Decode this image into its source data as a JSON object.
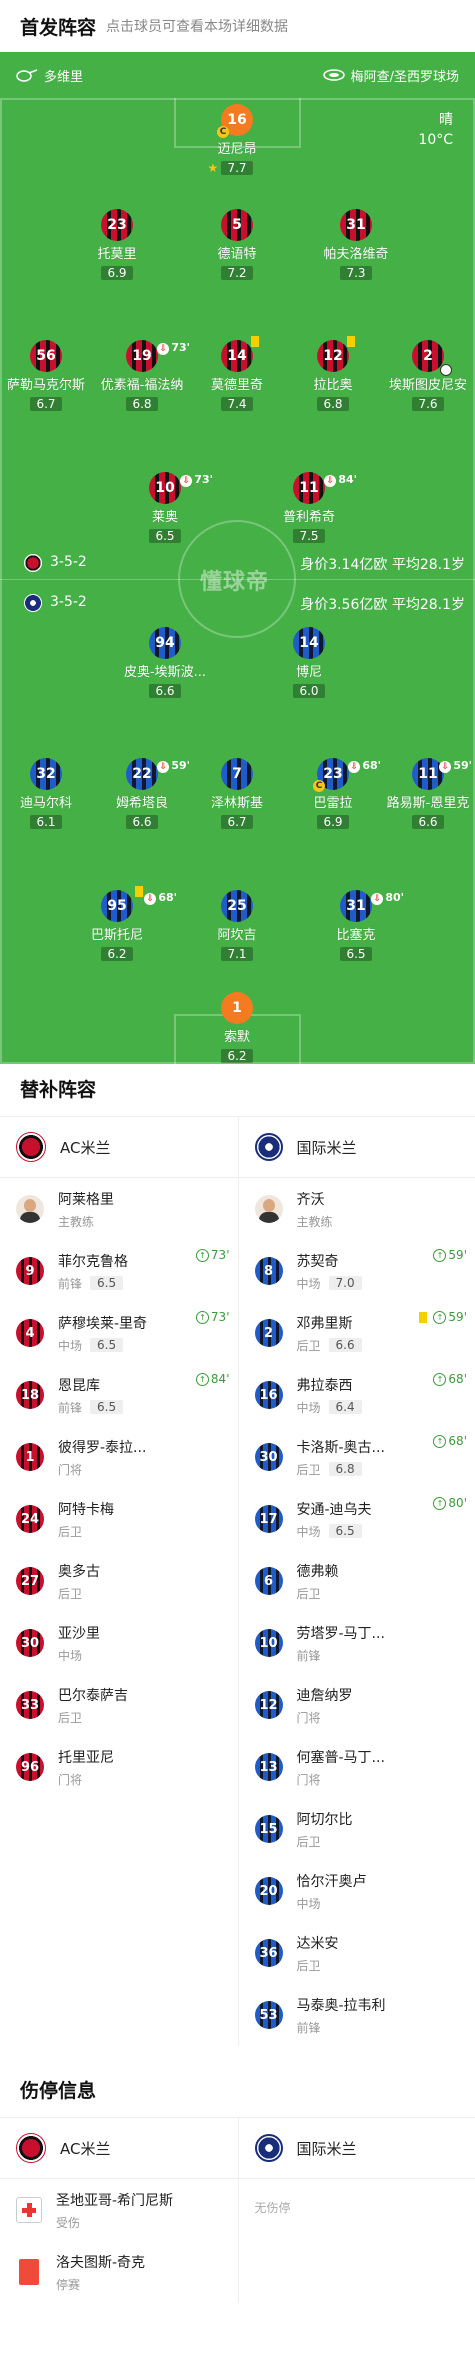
{
  "header": {
    "title": "首发阵容",
    "subtitle": "点击球员可查看本场详细数据"
  },
  "pitch": {
    "left_label": "多维里",
    "right_label": "梅阿查/圣西罗球场",
    "weather": "晴",
    "temp": "10°C",
    "watermark": "懂球帝",
    "home_formation": "3-5-2",
    "home_value": "身价3.14亿欧  平均28.1岁",
    "away_formation": "3-5-2",
    "away_value": "身价3.56亿欧  平均28.1岁"
  },
  "home_players": [
    {
      "num": "16",
      "name": "迈尼昂",
      "rating": "7.7"
    },
    {
      "num": "23",
      "name": "托莫里",
      "rating": "6.9"
    },
    {
      "num": "5",
      "name": "德语特",
      "rating": "7.2"
    },
    {
      "num": "31",
      "name": "帕夫洛维奇",
      "rating": "7.3"
    },
    {
      "num": "56",
      "name": "萨勒马克尔斯",
      "rating": "6.7"
    },
    {
      "num": "19",
      "name": "优素福-福法纳",
      "rating": "6.8",
      "sub": "73'"
    },
    {
      "num": "14",
      "name": "莫德里奇",
      "rating": "7.4"
    },
    {
      "num": "12",
      "name": "拉比奥",
      "rating": "6.8"
    },
    {
      "num": "2",
      "name": "埃斯图皮尼安",
      "rating": "7.6"
    },
    {
      "num": "10",
      "name": "莱奥",
      "rating": "6.5",
      "sub": "73'"
    },
    {
      "num": "11",
      "name": "普利希奇",
      "rating": "7.5",
      "sub": "84'"
    }
  ],
  "away_players": [
    {
      "num": "94",
      "name": "皮奥-埃斯波...",
      "rating": "6.6"
    },
    {
      "num": "14",
      "name": "博尼",
      "rating": "6.0"
    },
    {
      "num": "32",
      "name": "迪马尔科",
      "rating": "6.1"
    },
    {
      "num": "22",
      "name": "姆希塔良",
      "rating": "6.6",
      "sub": "59'"
    },
    {
      "num": "7",
      "name": "泽林斯基",
      "rating": "6.7"
    },
    {
      "num": "23",
      "name": "巴雷拉",
      "rating": "6.9",
      "sub": "68'"
    },
    {
      "num": "11",
      "name": "路易斯-恩里克",
      "rating": "6.6",
      "sub": "59'"
    },
    {
      "num": "95",
      "name": "巴斯托尼",
      "rating": "6.2",
      "sub": "68'"
    },
    {
      "num": "25",
      "name": "阿坎吉",
      "rating": "7.1"
    },
    {
      "num": "31",
      "name": "比塞克",
      "rating": "6.5",
      "sub": "80'"
    },
    {
      "num": "1",
      "name": "索默",
      "rating": "6.2"
    }
  ],
  "subs": {
    "title": "替补阵容",
    "home_team": "AC米兰",
    "away_team": "国际米兰",
    "home": [
      {
        "num": "",
        "name": "阿莱格里",
        "pos": "主教练"
      },
      {
        "num": "9",
        "name": "菲尔克鲁格",
        "pos": "前锋",
        "rating": "6.5",
        "time": "73'"
      },
      {
        "num": "4",
        "name": "萨穆埃莱-里奇",
        "pos": "中场",
        "rating": "6.5",
        "time": "73'"
      },
      {
        "num": "18",
        "name": "恩昆库",
        "pos": "前锋",
        "rating": "6.5",
        "time": "84'"
      },
      {
        "num": "1",
        "name": "彼得罗-泰拉...",
        "pos": "门将"
      },
      {
        "num": "24",
        "name": "阿特卡梅",
        "pos": "后卫"
      },
      {
        "num": "27",
        "name": "奥多古",
        "pos": "后卫"
      },
      {
        "num": "30",
        "name": "亚沙里",
        "pos": "中场"
      },
      {
        "num": "33",
        "name": "巴尔泰萨吉",
        "pos": "后卫"
      },
      {
        "num": "96",
        "name": "托里亚尼",
        "pos": "门将"
      }
    ],
    "away": [
      {
        "num": "",
        "name": "齐沃",
        "pos": "主教练"
      },
      {
        "num": "8",
        "name": "苏契奇",
        "pos": "中场",
        "rating": "7.0",
        "time": "59'"
      },
      {
        "num": "2",
        "name": "邓弗里斯",
        "pos": "后卫",
        "rating": "6.6",
        "time": "59'",
        "card": "yellow"
      },
      {
        "num": "16",
        "name": "弗拉泰西",
        "pos": "中场",
        "rating": "6.4",
        "time": "68'"
      },
      {
        "num": "30",
        "name": "卡洛斯-奥古...",
        "pos": "后卫",
        "rating": "6.8",
        "time": "68'"
      },
      {
        "num": "17",
        "name": "安通-迪乌夫",
        "pos": "中场",
        "rating": "6.5",
        "time": "80'"
      },
      {
        "num": "6",
        "name": "德弗赖",
        "pos": "后卫"
      },
      {
        "num": "10",
        "name": "劳塔罗-马丁...",
        "pos": "前锋"
      },
      {
        "num": "12",
        "name": "迪詹纳罗",
        "pos": "门将"
      },
      {
        "num": "13",
        "name": "何塞普-马丁...",
        "pos": "门将"
      },
      {
        "num": "15",
        "name": "阿切尔比",
        "pos": "后卫"
      },
      {
        "num": "20",
        "name": "恰尔汗奥卢",
        "pos": "中场"
      },
      {
        "num": "36",
        "name": "达米安",
        "pos": "后卫"
      },
      {
        "num": "53",
        "name": "马泰奥-拉韦利",
        "pos": "前锋"
      }
    ]
  },
  "injury": {
    "title": "伤停信息",
    "home_team": "AC米兰",
    "away_team": "国际米兰",
    "home": [
      {
        "name": "圣地亚哥-希门尼斯",
        "status": "受伤",
        "icon": "medical-cross-icon"
      },
      {
        "name": "洛夫图斯-奇克",
        "status": "停赛",
        "icon": "red-card-icon"
      }
    ],
    "away_none": "无伤停"
  },
  "colors": {
    "pitch": "#45b046",
    "milan": "#c8102e",
    "inter": "#1f5cc8"
  }
}
